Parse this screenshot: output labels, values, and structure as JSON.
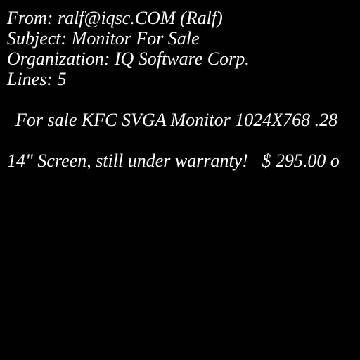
{
  "header": {
    "from": "From: ralf@iqsc.COM (Ralf)",
    "subject": "Subject: Monitor For Sale",
    "organization": "Organization: IQ Software Corp.",
    "lines": "Lines: 5"
  },
  "body": {
    "line1": "For sale KFC SVGA Monitor 1024X768 .28",
    "line2": "14\" Screen, still under warranty!   $ 295.00 o"
  },
  "colors": {
    "background": "#000000",
    "text": "#ffffff"
  }
}
